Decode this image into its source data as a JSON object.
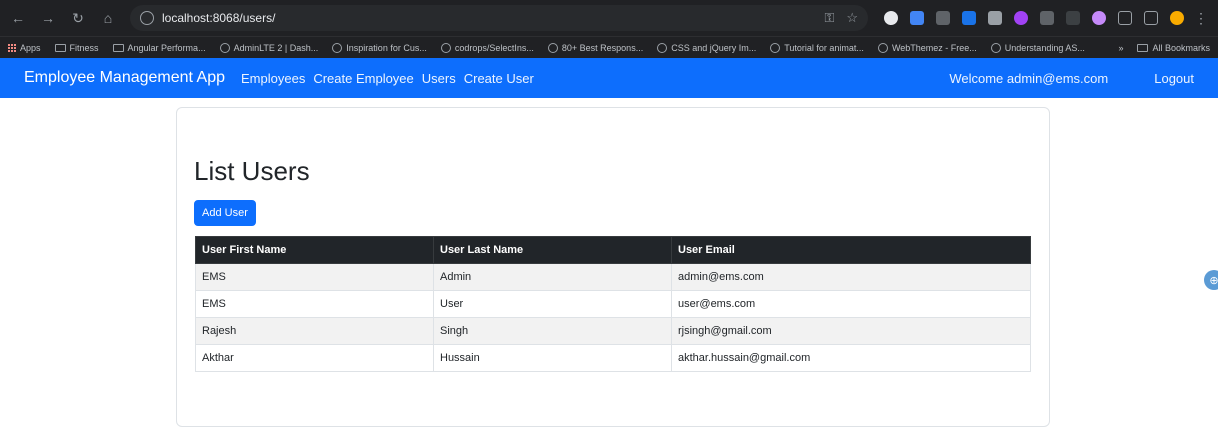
{
  "browser": {
    "url": "localhost:8068/users/",
    "bookmarks": [
      {
        "label": "Apps",
        "icon": "apps-icon"
      },
      {
        "label": "Fitness",
        "icon": "folder-icon"
      },
      {
        "label": "Angular Performa...",
        "icon": "folder-icon"
      },
      {
        "label": "AdminLTE 2 | Dash...",
        "icon": "globe-icon"
      },
      {
        "label": "Inspiration for Cus...",
        "icon": "globe-icon"
      },
      {
        "label": "codrops/SelectIns...",
        "icon": "globe-icon"
      },
      {
        "label": "80+ Best Respons...",
        "icon": "globe-icon"
      },
      {
        "label": "CSS and jQuery Im...",
        "icon": "globe-icon"
      },
      {
        "label": "Tutorial for animat...",
        "icon": "globe-icon"
      },
      {
        "label": "WebThemez - Free...",
        "icon": "globe-icon"
      },
      {
        "label": "Understanding AS...",
        "icon": "globe-icon"
      }
    ],
    "more_label": "»",
    "all_bookmarks_label": "All Bookmarks"
  },
  "navbar": {
    "brand": "Employee Management App",
    "links": [
      "Employees",
      "Create Employee",
      "Users",
      "Create User"
    ],
    "welcome": "Welcome admin@ems.com",
    "logout": "Logout",
    "color": "#0d6efd"
  },
  "main": {
    "title": "List Users",
    "add_button": "Add User",
    "table": {
      "headers": [
        "User First Name",
        "User Last Name",
        "User Email"
      ],
      "rows": [
        [
          "EMS",
          "Admin",
          "admin@ems.com"
        ],
        [
          "EMS",
          "User",
          "user@ems.com"
        ],
        [
          "Rajesh",
          "Singh",
          "rjsingh@gmail.com"
        ],
        [
          "Akthar",
          "Hussain",
          "akthar.hussain@gmail.com"
        ]
      ]
    }
  }
}
